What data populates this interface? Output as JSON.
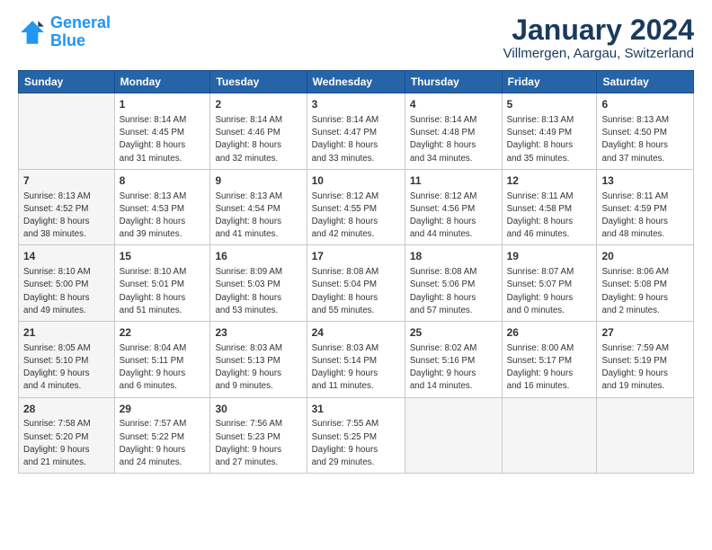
{
  "header": {
    "logo_line1": "General",
    "logo_line2": "Blue",
    "main_title": "January 2024",
    "subtitle": "Villmergen, Aargau, Switzerland"
  },
  "calendar": {
    "days_of_week": [
      "Sunday",
      "Monday",
      "Tuesday",
      "Wednesday",
      "Thursday",
      "Friday",
      "Saturday"
    ],
    "weeks": [
      [
        {
          "day": "",
          "info": ""
        },
        {
          "day": "1",
          "info": "Sunrise: 8:14 AM\nSunset: 4:45 PM\nDaylight: 8 hours\nand 31 minutes."
        },
        {
          "day": "2",
          "info": "Sunrise: 8:14 AM\nSunset: 4:46 PM\nDaylight: 8 hours\nand 32 minutes."
        },
        {
          "day": "3",
          "info": "Sunrise: 8:14 AM\nSunset: 4:47 PM\nDaylight: 8 hours\nand 33 minutes."
        },
        {
          "day": "4",
          "info": "Sunrise: 8:14 AM\nSunset: 4:48 PM\nDaylight: 8 hours\nand 34 minutes."
        },
        {
          "day": "5",
          "info": "Sunrise: 8:13 AM\nSunset: 4:49 PM\nDaylight: 8 hours\nand 35 minutes."
        },
        {
          "day": "6",
          "info": "Sunrise: 8:13 AM\nSunset: 4:50 PM\nDaylight: 8 hours\nand 37 minutes."
        }
      ],
      [
        {
          "day": "7",
          "info": "Sunrise: 8:13 AM\nSunset: 4:52 PM\nDaylight: 8 hours\nand 38 minutes."
        },
        {
          "day": "8",
          "info": "Sunrise: 8:13 AM\nSunset: 4:53 PM\nDaylight: 8 hours\nand 39 minutes."
        },
        {
          "day": "9",
          "info": "Sunrise: 8:13 AM\nSunset: 4:54 PM\nDaylight: 8 hours\nand 41 minutes."
        },
        {
          "day": "10",
          "info": "Sunrise: 8:12 AM\nSunset: 4:55 PM\nDaylight: 8 hours\nand 42 minutes."
        },
        {
          "day": "11",
          "info": "Sunrise: 8:12 AM\nSunset: 4:56 PM\nDaylight: 8 hours\nand 44 minutes."
        },
        {
          "day": "12",
          "info": "Sunrise: 8:11 AM\nSunset: 4:58 PM\nDaylight: 8 hours\nand 46 minutes."
        },
        {
          "day": "13",
          "info": "Sunrise: 8:11 AM\nSunset: 4:59 PM\nDaylight: 8 hours\nand 48 minutes."
        }
      ],
      [
        {
          "day": "14",
          "info": "Sunrise: 8:10 AM\nSunset: 5:00 PM\nDaylight: 8 hours\nand 49 minutes."
        },
        {
          "day": "15",
          "info": "Sunrise: 8:10 AM\nSunset: 5:01 PM\nDaylight: 8 hours\nand 51 minutes."
        },
        {
          "day": "16",
          "info": "Sunrise: 8:09 AM\nSunset: 5:03 PM\nDaylight: 8 hours\nand 53 minutes."
        },
        {
          "day": "17",
          "info": "Sunrise: 8:08 AM\nSunset: 5:04 PM\nDaylight: 8 hours\nand 55 minutes."
        },
        {
          "day": "18",
          "info": "Sunrise: 8:08 AM\nSunset: 5:06 PM\nDaylight: 8 hours\nand 57 minutes."
        },
        {
          "day": "19",
          "info": "Sunrise: 8:07 AM\nSunset: 5:07 PM\nDaylight: 9 hours\nand 0 minutes."
        },
        {
          "day": "20",
          "info": "Sunrise: 8:06 AM\nSunset: 5:08 PM\nDaylight: 9 hours\nand 2 minutes."
        }
      ],
      [
        {
          "day": "21",
          "info": "Sunrise: 8:05 AM\nSunset: 5:10 PM\nDaylight: 9 hours\nand 4 minutes."
        },
        {
          "day": "22",
          "info": "Sunrise: 8:04 AM\nSunset: 5:11 PM\nDaylight: 9 hours\nand 6 minutes."
        },
        {
          "day": "23",
          "info": "Sunrise: 8:03 AM\nSunset: 5:13 PM\nDaylight: 9 hours\nand 9 minutes."
        },
        {
          "day": "24",
          "info": "Sunrise: 8:03 AM\nSunset: 5:14 PM\nDaylight: 9 hours\nand 11 minutes."
        },
        {
          "day": "25",
          "info": "Sunrise: 8:02 AM\nSunset: 5:16 PM\nDaylight: 9 hours\nand 14 minutes."
        },
        {
          "day": "26",
          "info": "Sunrise: 8:00 AM\nSunset: 5:17 PM\nDaylight: 9 hours\nand 16 minutes."
        },
        {
          "day": "27",
          "info": "Sunrise: 7:59 AM\nSunset: 5:19 PM\nDaylight: 9 hours\nand 19 minutes."
        }
      ],
      [
        {
          "day": "28",
          "info": "Sunrise: 7:58 AM\nSunset: 5:20 PM\nDaylight: 9 hours\nand 21 minutes."
        },
        {
          "day": "29",
          "info": "Sunrise: 7:57 AM\nSunset: 5:22 PM\nDaylight: 9 hours\nand 24 minutes."
        },
        {
          "day": "30",
          "info": "Sunrise: 7:56 AM\nSunset: 5:23 PM\nDaylight: 9 hours\nand 27 minutes."
        },
        {
          "day": "31",
          "info": "Sunrise: 7:55 AM\nSunset: 5:25 PM\nDaylight: 9 hours\nand 29 minutes."
        },
        {
          "day": "",
          "info": ""
        },
        {
          "day": "",
          "info": ""
        },
        {
          "day": "",
          "info": ""
        }
      ]
    ]
  }
}
